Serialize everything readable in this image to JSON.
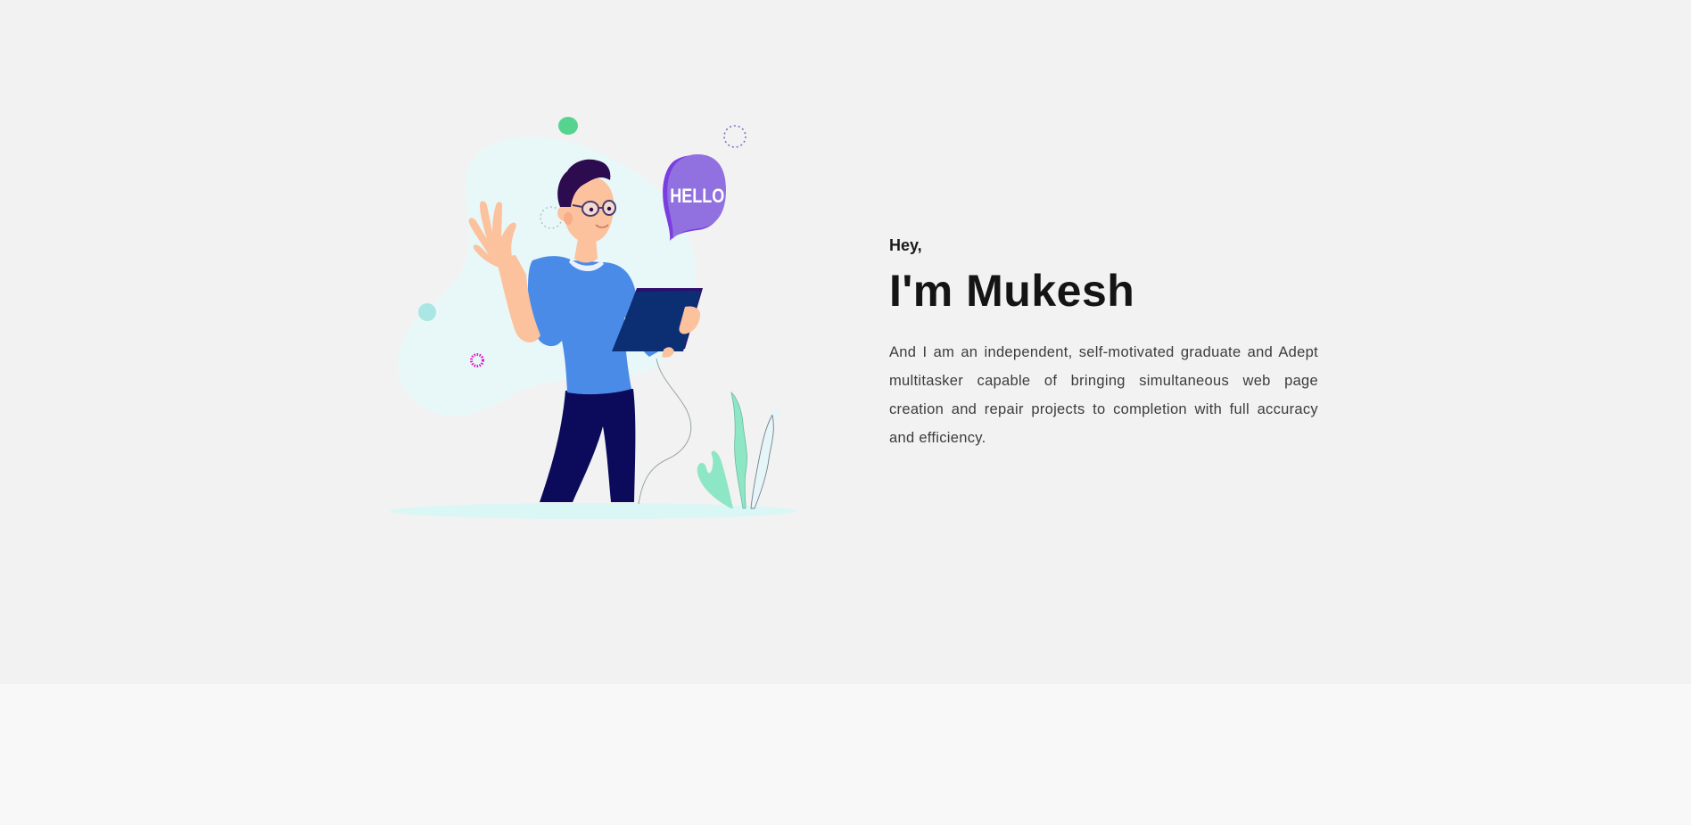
{
  "hero": {
    "greeting": "Hey,",
    "name": "I'm Mukesh",
    "bio": "And I am an independent, self-motivated graduate and Adept multitasker capable of bringing simultaneous web page creation and repair projects to completion with full accuracy and efficiency."
  },
  "illustration": {
    "speech_bubble_text": "HELLO"
  },
  "colors": {
    "hero_background": "#f2f2f2",
    "lower_background": "#f8f8f8",
    "shirt": "#4b8be8",
    "pants": "#0c0a5a",
    "tablet": "#0b2f72",
    "bubble": "#9170e0",
    "blob": "#e8f8f8",
    "plant": "#8de6c4"
  }
}
